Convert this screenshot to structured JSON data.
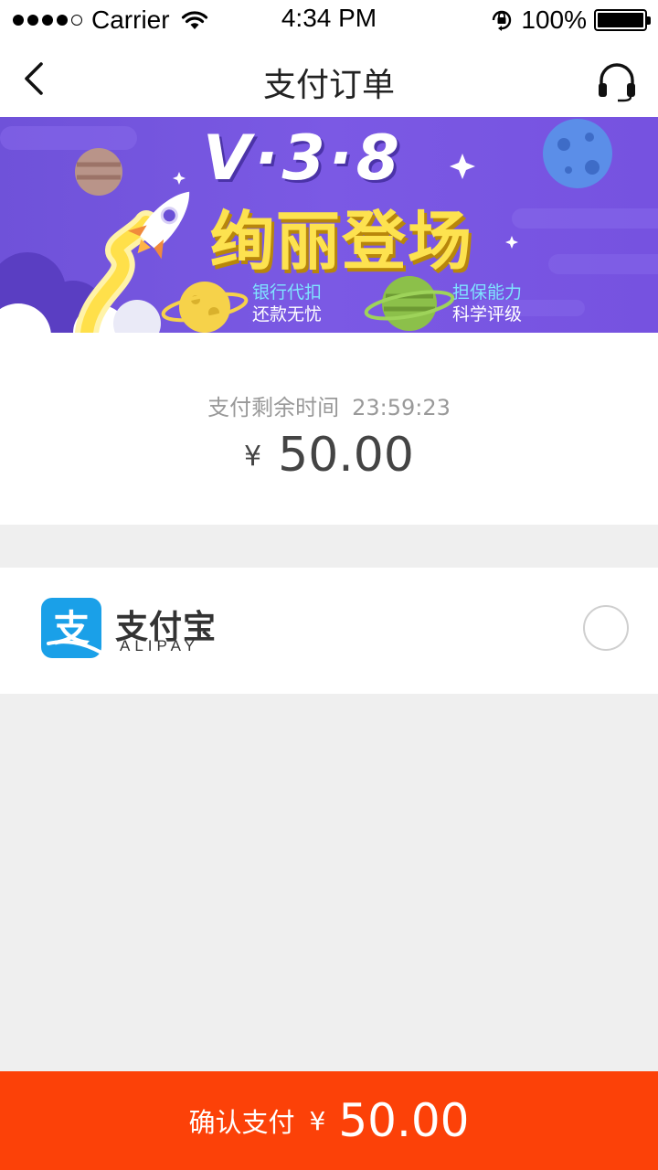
{
  "status_bar": {
    "carrier": "Carrier",
    "time": "4:34 PM",
    "battery": "100%"
  },
  "nav": {
    "title": "支付订单",
    "back_icon": "chevron-left-icon",
    "service_icon": "headset-icon"
  },
  "banner": {
    "version": "V·3·8",
    "slogan": "绚丽登场",
    "tag_left_line1": "银行代扣",
    "tag_left_line2": "还款无忧",
    "tag_right_line1": "担保能力",
    "tag_right_line2": "科学评级"
  },
  "order": {
    "countdown_label": "支付剩余时间",
    "countdown_time": "23:59:23",
    "currency": "¥",
    "amount": "50.00"
  },
  "payment_method": {
    "name": "支付宝",
    "subtitle": "ALIPAY",
    "logo_char": "支",
    "selected": false
  },
  "confirm": {
    "label": "确认支付",
    "currency": "¥",
    "amount": "50.00"
  },
  "colors": {
    "accent": "#fc4108",
    "alipay_blue": "#1aa0e8",
    "banner_purple": "#7656e2",
    "background": "#efefef"
  }
}
